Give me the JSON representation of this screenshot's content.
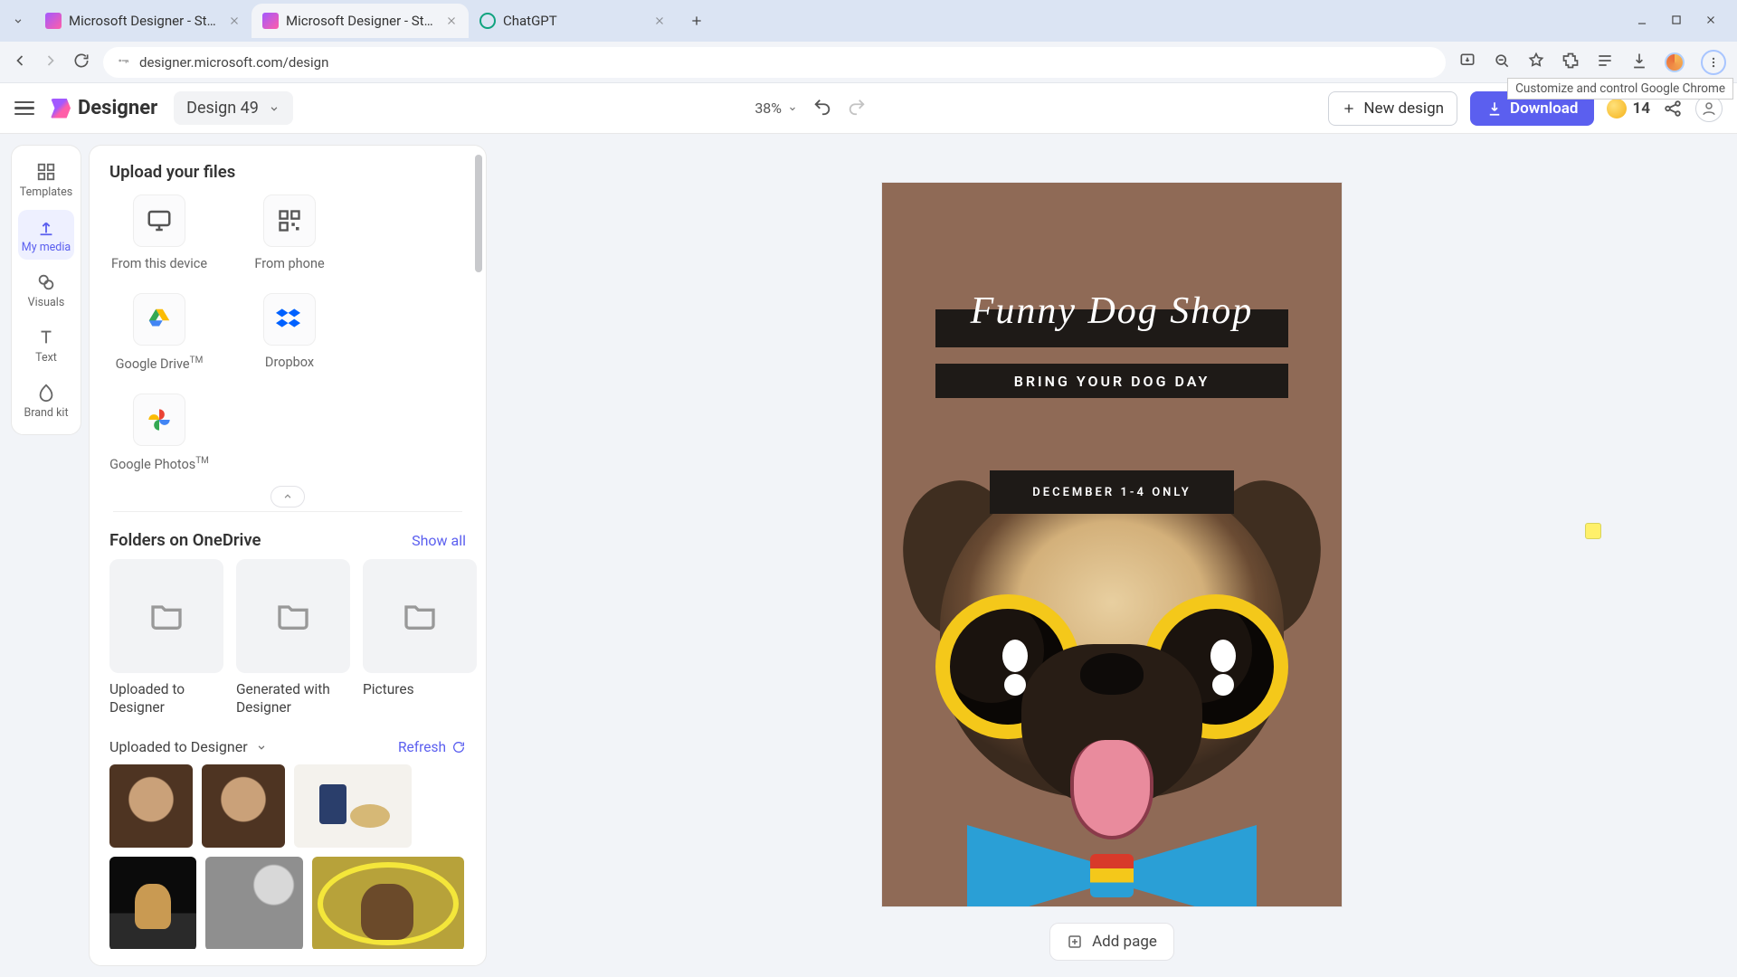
{
  "browser": {
    "tabs": [
      {
        "title": "Microsoft Designer - Stunning",
        "active": false,
        "favicon_color": "#a259ff"
      },
      {
        "title": "Microsoft Designer - Stunning",
        "active": true,
        "favicon_color": "#a259ff"
      },
      {
        "title": "ChatGPT",
        "active": false,
        "favicon_color": "#10a37f"
      }
    ],
    "url": "designer.microsoft.com/design",
    "menu_tooltip": "Customize and control Google Chrome"
  },
  "header": {
    "app_name": "Designer",
    "design_name": "Design 49",
    "zoom": "38%",
    "new_design": "New design",
    "download": "Download",
    "credits": "14"
  },
  "rail": {
    "items": [
      {
        "id": "templates",
        "label": "Templates"
      },
      {
        "id": "my-media",
        "label": "My media"
      },
      {
        "id": "visuals",
        "label": "Visuals"
      },
      {
        "id": "text",
        "label": "Text"
      },
      {
        "id": "brand-kit",
        "label": "Brand kit"
      }
    ],
    "active": "my-media"
  },
  "panel": {
    "upload_title": "Upload your files",
    "upload_options": [
      {
        "id": "device",
        "label": "From this device"
      },
      {
        "id": "phone",
        "label": "From phone"
      },
      {
        "id": "gdrive",
        "label": "Google Drive",
        "tm": true
      },
      {
        "id": "dropbox",
        "label": "Dropbox"
      },
      {
        "id": "gphotos",
        "label": "Google Photos",
        "tm": true
      }
    ],
    "folders_title": "Folders on OneDrive",
    "show_all": "Show all",
    "folders": [
      {
        "label": "Uploaded to Designer"
      },
      {
        "label": "Generated with Designer"
      },
      {
        "label": "Pictures"
      }
    ],
    "uploaded_section": "Uploaded to Designer",
    "refresh": "Refresh"
  },
  "canvas": {
    "title_script": "Funny Dog Shop",
    "subtitle": "BRING YOUR DOG DAY",
    "date_banner": "DECEMBER 1-4 ONLY",
    "add_page": "Add page"
  }
}
